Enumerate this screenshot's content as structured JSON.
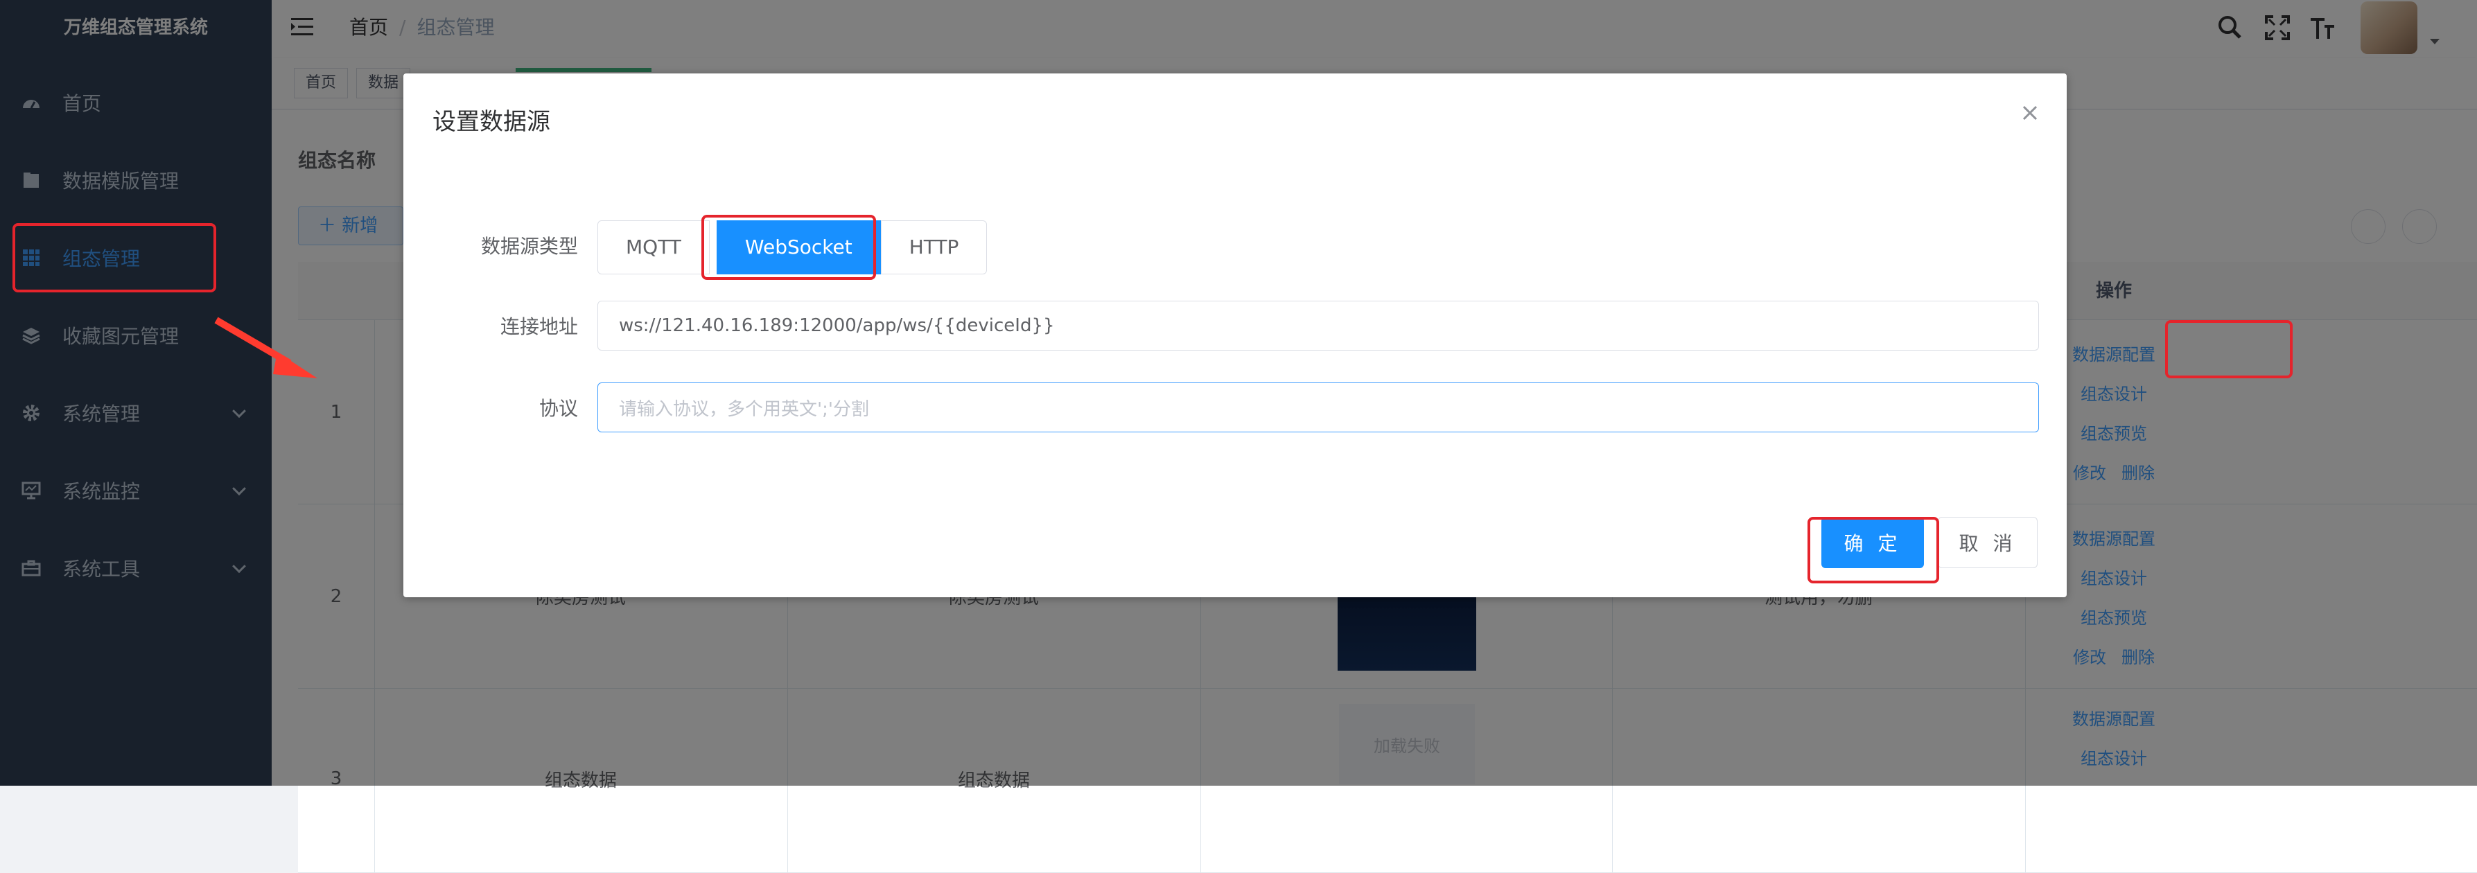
{
  "app": {
    "title": "万维组态管理系统"
  },
  "sidebar": {
    "items": [
      {
        "label": "首页",
        "icon": "dashboard-icon"
      },
      {
        "label": "数据模版管理",
        "icon": "folder-icon"
      },
      {
        "label": "组态管理",
        "icon": "grid-icon",
        "active": true
      },
      {
        "label": "收藏图元管理",
        "icon": "layers-icon"
      },
      {
        "label": "系统管理",
        "icon": "gear-icon"
      },
      {
        "label": "系统监控",
        "icon": "monitor-icon"
      },
      {
        "label": "系统工具",
        "icon": "toolbox-icon"
      }
    ]
  },
  "header": {
    "breadcrumb": {
      "home": "首页",
      "sep": "/",
      "current": "组态管理"
    }
  },
  "tags": {
    "items": [
      "首页",
      "数据"
    ]
  },
  "main": {
    "search_label": "组态名称",
    "add_button": "新增",
    "table": {
      "ops_header": "操作",
      "rows": [
        {
          "index": "1",
          "col1": "",
          "col2": "",
          "col4": ""
        },
        {
          "index": "2",
          "col1": "陈奕房测试",
          "col2": "陈奕房测试",
          "col4": "测试用，勿删"
        },
        {
          "index": "3",
          "col1": "组态数据",
          "col2": "组态数据",
          "col4": "",
          "thumb_text": "加载失败"
        }
      ],
      "ops": {
        "ds_config": "数据源配置",
        "design": "组态设计",
        "preview": "组态预览",
        "edit": "修改",
        "delete": "删除"
      }
    }
  },
  "dialog": {
    "title": "设置数据源",
    "type_label": "数据源类型",
    "types": [
      "MQTT",
      "WebSocket",
      "HTTP"
    ],
    "selected_type": "WebSocket",
    "address_label": "连接地址",
    "address_value": "ws://121.40.16.189:12000/app/ws/{{deviceId}}",
    "protocol_label": "协议",
    "protocol_placeholder": "请输入协议，多个用英文';'分割",
    "confirm_button": "确 定",
    "cancel_button": "取 消"
  },
  "colors": {
    "sidebar_bg": "#304156",
    "primary": "#1890ff",
    "annotation_red": "#e5242c"
  }
}
